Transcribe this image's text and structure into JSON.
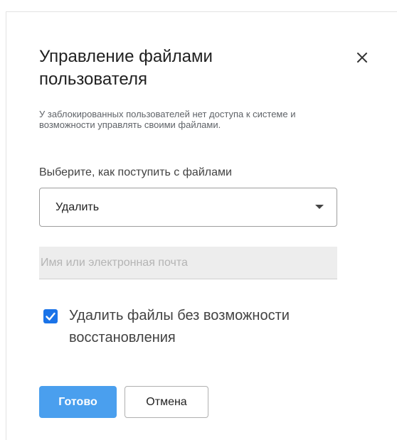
{
  "dialog": {
    "title": "Управление файлами пользователя",
    "description": "У заблокированных пользователей нет доступа к системе и возможности управлять своими файлами.",
    "choose_label": "Выберите, как поступить с файлами",
    "select": {
      "value": "Удалить"
    },
    "search": {
      "placeholder": "Имя или электронная почта",
      "value": ""
    },
    "checkbox": {
      "label": "Удалить файлы без возможности восстановления",
      "checked": true
    },
    "buttons": {
      "done": "Готово",
      "cancel": "Отмена"
    },
    "icons": {
      "close": "close-icon",
      "dropdown": "dropdown-arrow-icon",
      "check": "check-icon"
    },
    "colors": {
      "primary": "#4a9fee",
      "checkbox": "#1a73e8"
    }
  }
}
